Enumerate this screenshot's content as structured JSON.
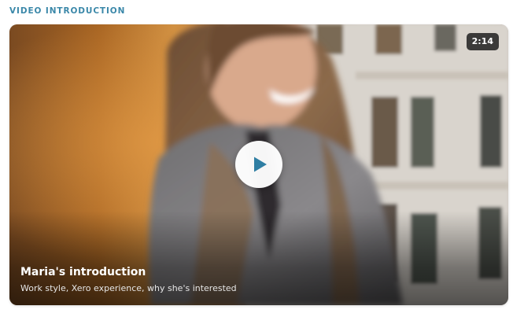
{
  "section": {
    "label": "VIDEO INTRODUCTION"
  },
  "video": {
    "duration": "2:14",
    "title": "Maria's introduction",
    "subtitle": "Work style, Xero experience, why she's interested"
  },
  "icons": {
    "play": "play-icon"
  },
  "colors": {
    "accent": "#3b88a9",
    "play_icon": "#2f7ea3",
    "badge_bg": "#191919",
    "caption_text": "#ffffff"
  }
}
